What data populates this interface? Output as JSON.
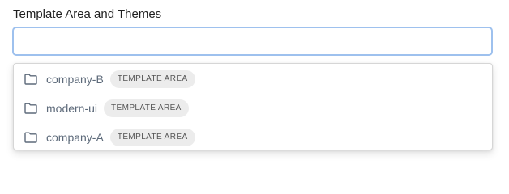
{
  "field": {
    "label": "Template Area and Themes",
    "value": "",
    "placeholder": ""
  },
  "options": [
    {
      "icon": "folder-icon",
      "name": "company-B",
      "badge": "TEMPLATE AREA"
    },
    {
      "icon": "folder-icon",
      "name": "modern-ui",
      "badge": "TEMPLATE AREA"
    },
    {
      "icon": "folder-icon",
      "name": "company-A",
      "badge": "TEMPLATE AREA"
    }
  ],
  "colors": {
    "input_focus_border": "#9ec1ee",
    "option_text": "#5d6a7a",
    "badge_bg": "#ececec"
  }
}
